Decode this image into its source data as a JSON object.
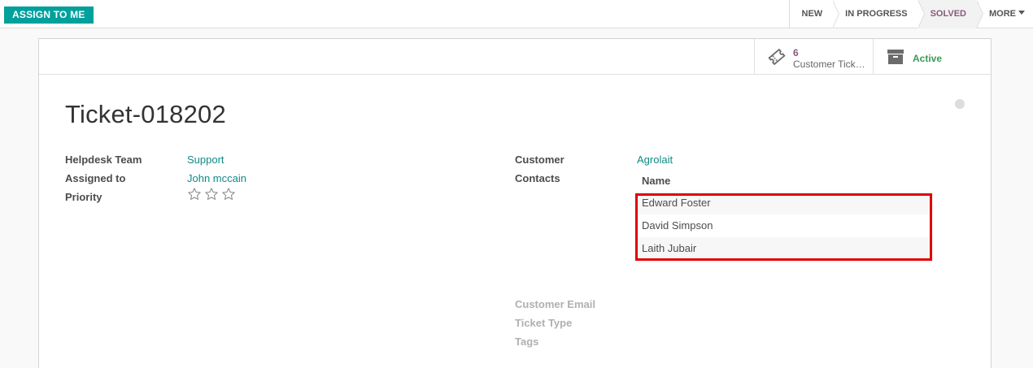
{
  "statusbar": {
    "assign_label": "ASSIGN TO ME",
    "stages": [
      {
        "label": "NEW",
        "active": false
      },
      {
        "label": "IN PROGRESS",
        "active": false
      },
      {
        "label": "SOLVED",
        "active": true
      }
    ],
    "more_label": "MORE"
  },
  "buttons": {
    "tickets_count": "6",
    "tickets_label": "Customer Tickets",
    "active_label": "Active",
    "tickets_icon": "ticket-icon",
    "archive_icon": "archive-icon"
  },
  "ticket": {
    "title": "Ticket-018202"
  },
  "left_fields": {
    "team_label": "Helpdesk Team",
    "team_value": "Support",
    "assigned_label": "Assigned to",
    "assigned_value": "John mccain",
    "priority_label": "Priority",
    "priority_stars": 0,
    "priority_max": 3
  },
  "right_fields": {
    "customer_label": "Customer",
    "customer_value": "Agrolait",
    "contacts_label": "Contacts",
    "email_label": "Customer Email",
    "type_label": "Ticket Type",
    "tags_label": "Tags"
  },
  "contacts_table": {
    "header": "Name",
    "rows": [
      "Edward Foster",
      "David Simpson",
      "Laith Jubair"
    ]
  },
  "colors": {
    "accent": "#00a09d",
    "stage_active": "#875a7b",
    "highlight": "#e00000",
    "active_status": "#3a9a5a"
  }
}
